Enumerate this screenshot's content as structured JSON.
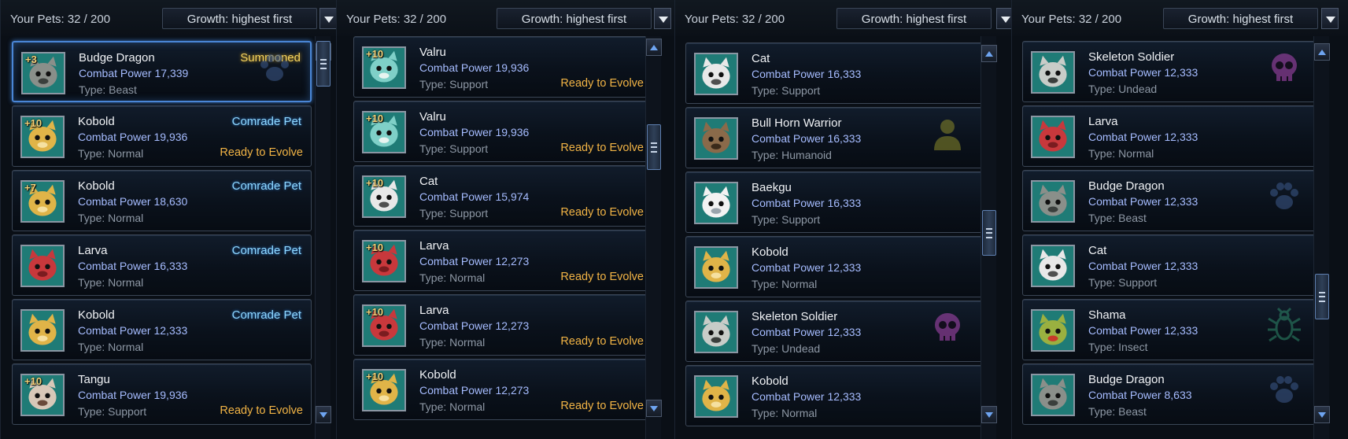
{
  "panels": [
    {
      "pets_count": "Your Pets: 32 / 200",
      "sort_label": "Growth: highest first",
      "cards": [
        {
          "level": "+3",
          "name": "Budge Dragon",
          "power": "Combat Power 17,339",
          "type": "Type: Beast",
          "top_badge": "Summoned",
          "top_badge_style": "summoned",
          "bottom_badge": "",
          "icon": "paw-icon",
          "portrait_color": "#2e3b44",
          "selected": true
        },
        {
          "level": "+10",
          "name": "Kobold",
          "power": "Combat Power 19,936",
          "type": "Type: Normal",
          "top_badge": "Comrade Pet",
          "top_badge_style": "comrade",
          "bottom_badge": "Ready to Evolve",
          "icon": "",
          "portrait_color": "#1e7a74"
        },
        {
          "level": "+7",
          "name": "Kobold",
          "power": "Combat Power 18,630",
          "type": "Type: Normal",
          "top_badge": "Comrade Pet",
          "top_badge_style": "comrade",
          "bottom_badge": "",
          "icon": "",
          "portrait_color": "#1e7a74"
        },
        {
          "level": "",
          "name": "Larva",
          "power": "Combat Power 16,333",
          "type": "Type: Normal",
          "top_badge": "Comrade Pet",
          "top_badge_style": "comrade",
          "bottom_badge": "",
          "icon": "",
          "portrait_color": "#1e7a74"
        },
        {
          "level": "",
          "name": "Kobold",
          "power": "Combat Power 12,333",
          "type": "Type: Normal",
          "top_badge": "Comrade Pet",
          "top_badge_style": "comrade",
          "bottom_badge": "",
          "icon": "",
          "portrait_color": "#1e7a74"
        },
        {
          "level": "+10",
          "name": "Tangu",
          "power": "Combat Power 19,936",
          "type": "Type: Support",
          "top_badge": "",
          "top_badge_style": "",
          "bottom_badge": "Ready to Evolve",
          "icon": "",
          "portrait_color": "#1e7a74"
        }
      ]
    },
    {
      "pets_count": "Your Pets: 32 / 200",
      "sort_label": "Growth: highest first",
      "cards": [
        {
          "level": "+10",
          "name": "Valru",
          "power": "Combat Power 19,936",
          "type": "Type: Support",
          "top_badge": "",
          "top_badge_style": "",
          "bottom_badge": "Ready to Evolve",
          "icon": "",
          "portrait_color": "#1e7a74"
        },
        {
          "level": "+10",
          "name": "Valru",
          "power": "Combat Power 19,936",
          "type": "Type: Support",
          "top_badge": "",
          "top_badge_style": "",
          "bottom_badge": "Ready to Evolve",
          "icon": "",
          "portrait_color": "#1e7a74"
        },
        {
          "level": "+10",
          "name": "Cat",
          "power": "Combat Power 15,974",
          "type": "Type: Support",
          "top_badge": "",
          "top_badge_style": "",
          "bottom_badge": "Ready to Evolve",
          "icon": "",
          "portrait_color": "#1e7a74"
        },
        {
          "level": "+10",
          "name": "Larva",
          "power": "Combat Power 12,273",
          "type": "Type: Normal",
          "top_badge": "",
          "top_badge_style": "",
          "bottom_badge": "Ready to Evolve",
          "icon": "",
          "portrait_color": "#1e7a74"
        },
        {
          "level": "+10",
          "name": "Larva",
          "power": "Combat Power 12,273",
          "type": "Type: Normal",
          "top_badge": "",
          "top_badge_style": "",
          "bottom_badge": "Ready to Evolve",
          "icon": "",
          "portrait_color": "#1e7a74"
        },
        {
          "level": "+10",
          "name": "Kobold",
          "power": "Combat Power 12,273",
          "type": "Type: Normal",
          "top_badge": "",
          "top_badge_style": "",
          "bottom_badge": "Ready to Evolve",
          "icon": "",
          "portrait_color": "#1e7a74"
        }
      ]
    },
    {
      "pets_count": "Your Pets: 32 / 200",
      "sort_label": "Growth: highest first",
      "cards": [
        {
          "level": "",
          "name": "Cat",
          "power": "Combat Power 16,333",
          "type": "Type: Support",
          "top_badge": "",
          "top_badge_style": "",
          "bottom_badge": "",
          "icon": "",
          "portrait_color": "#1e7a74"
        },
        {
          "level": "",
          "name": "Bull Horn Warrior",
          "power": "Combat Power 16,333",
          "type": "Type: Humanoid",
          "top_badge": "",
          "top_badge_style": "",
          "bottom_badge": "",
          "icon": "person-icon",
          "portrait_color": "#1e7a74"
        },
        {
          "level": "",
          "name": "Baekgu",
          "power": "Combat Power 16,333",
          "type": "Type: Support",
          "top_badge": "",
          "top_badge_style": "",
          "bottom_badge": "",
          "icon": "",
          "portrait_color": "#1e7a74"
        },
        {
          "level": "",
          "name": "Kobold",
          "power": "Combat Power 12,333",
          "type": "Type: Normal",
          "top_badge": "",
          "top_badge_style": "",
          "bottom_badge": "",
          "icon": "",
          "portrait_color": "#1e7a74"
        },
        {
          "level": "",
          "name": "Skeleton Soldier",
          "power": "Combat Power 12,333",
          "type": "Type: Undead",
          "top_badge": "",
          "top_badge_style": "",
          "bottom_badge": "",
          "icon": "skull-icon",
          "portrait_color": "#1e7a74"
        },
        {
          "level": "",
          "name": "Kobold",
          "power": "Combat Power 12,333",
          "type": "Type: Normal",
          "top_badge": "",
          "top_badge_style": "",
          "bottom_badge": "",
          "icon": "",
          "portrait_color": "#1e7a74"
        }
      ]
    },
    {
      "pets_count": "Your Pets: 32 / 200",
      "sort_label": "Growth: highest first",
      "cards": [
        {
          "level": "",
          "name": "Skeleton Soldier",
          "power": "Combat Power 12,333",
          "type": "Type: Undead",
          "top_badge": "",
          "top_badge_style": "",
          "bottom_badge": "",
          "icon": "skull-icon",
          "portrait_color": "#1e7a74"
        },
        {
          "level": "",
          "name": "Larva",
          "power": "Combat Power 12,333",
          "type": "Type: Normal",
          "top_badge": "",
          "top_badge_style": "",
          "bottom_badge": "",
          "icon": "",
          "portrait_color": "#1e7a74"
        },
        {
          "level": "",
          "name": "Budge Dragon",
          "power": "Combat Power 12,333",
          "type": "Type: Beast",
          "top_badge": "",
          "top_badge_style": "",
          "bottom_badge": "",
          "icon": "paw-icon",
          "portrait_color": "#1e7a74"
        },
        {
          "level": "",
          "name": "Cat",
          "power": "Combat Power 12,333",
          "type": "Type: Support",
          "top_badge": "",
          "top_badge_style": "",
          "bottom_badge": "",
          "icon": "",
          "portrait_color": "#1e7a74"
        },
        {
          "level": "",
          "name": "Shama",
          "power": "Combat Power 12,333",
          "type": "Type: Insect",
          "top_badge": "",
          "top_badge_style": "",
          "bottom_badge": "",
          "icon": "bug-icon",
          "portrait_color": "#1e7a74"
        },
        {
          "level": "",
          "name": "Budge Dragon",
          "power": "Combat Power 8,633",
          "type": "Type: Beast",
          "top_badge": "",
          "top_badge_style": "",
          "bottom_badge": "",
          "icon": "paw-icon",
          "portrait_color": "#1e7a74"
        }
      ]
    }
  ],
  "colors": {
    "power_text": "#a6bcff",
    "ready_to_evolve": "#f2b445",
    "comrade_pet": "#8ed7ff",
    "summoned": "#f4d25e",
    "icon_paw": "#3d5a8c",
    "icon_skull": "#b04ab8",
    "icon_person": "#8a8a2a",
    "icon_bug": "#2e8a6a"
  }
}
